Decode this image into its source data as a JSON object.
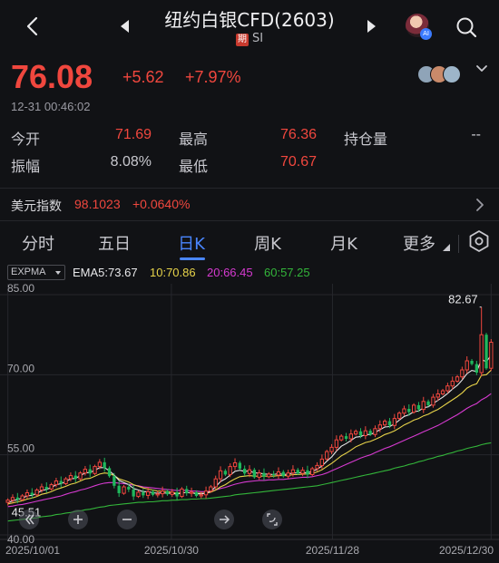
{
  "header": {
    "title": "纽约白银CFD(2603)",
    "badge": "期",
    "code": "SI"
  },
  "quote": {
    "price": "76.08",
    "change": "+5.62",
    "change_pct": "+7.97%",
    "time": "12-31 00:46:02"
  },
  "stats": {
    "open_label": "今开",
    "open": "71.69",
    "high_label": "最高",
    "high": "76.36",
    "oi_label": "持仓量",
    "oi": "--",
    "amp_label": "振幅",
    "amp": "8.08%",
    "low_label": "最低",
    "low": "70.67"
  },
  "usd_index": {
    "label": "美元指数",
    "value": "98.1023",
    "change": "+0.0640%"
  },
  "tabs": [
    {
      "label": "分时"
    },
    {
      "label": "五日"
    },
    {
      "label": "日K"
    },
    {
      "label": "周K"
    },
    {
      "label": "月K"
    },
    {
      "label": "更多"
    }
  ],
  "indicator": {
    "selected": "EXPMA",
    "ema5": "EMA5:73.67",
    "ema10": "10:70.86",
    "ema20": "20:66.45",
    "ema60": "60:57.25"
  },
  "colors": {
    "up": "#f0473e",
    "down": "#1fb75c",
    "ema5": "#e8e8ea",
    "ema10": "#e8d44a",
    "ema20": "#d63ad0",
    "ema60": "#33b53a",
    "accent": "#4a86ff"
  },
  "chart_data": {
    "type": "candlestick",
    "y_ticks": [
      "85.00",
      "70.00",
      "55.00",
      "40.00"
    ],
    "ylim": [
      40,
      85
    ],
    "x_ticks": [
      "2025/10/01",
      "2025/10/30",
      "2025/11/28",
      "2025/12/30"
    ],
    "annotations": {
      "max": "82.67",
      "min": "45.51"
    },
    "closes": [
      46.5,
      47.0,
      46.6,
      47.3,
      47.9,
      47.5,
      48.4,
      49.0,
      48.6,
      49.4,
      50.1,
      49.6,
      50.5,
      51.1,
      50.5,
      51.6,
      52.3,
      51.5,
      52.8,
      53.6,
      52.5,
      51.0,
      49.2,
      47.8,
      49.0,
      48.5,
      47.2,
      48.0,
      47.4,
      48.1,
      47.5,
      47.7,
      48.2,
      47.6,
      48.0,
      47.2,
      48.6,
      47.8,
      48.0,
      47.3,
      47.5,
      48.2,
      49.0,
      50.5,
      52.0,
      51.3,
      52.8,
      53.5,
      52.4,
      51.5,
      52.2,
      50.8,
      51.6,
      50.9,
      51.4,
      51.2,
      51.8,
      51.0,
      51.6,
      52.2,
      51.5,
      52.1,
      51.3,
      52.4,
      53.0,
      54.2,
      55.6,
      56.4,
      57.8,
      58.5,
      58.0,
      58.9,
      59.4,
      58.6,
      59.5,
      58.8,
      59.9,
      60.6,
      61.3,
      60.5,
      61.8,
      62.8,
      63.6,
      63.0,
      64.3,
      63.5,
      65.0,
      64.3,
      65.8,
      66.4,
      67.0,
      67.9,
      68.8,
      69.6,
      70.9,
      72.6,
      72.0,
      70.4,
      77.5,
      71.2,
      76.08
    ],
    "ema5": [
      46.0,
      46.4,
      46.6,
      46.9,
      47.3,
      47.4,
      47.8,
      48.3,
      48.5,
      48.9,
      49.4,
      49.6,
      50.0,
      50.5,
      50.6,
      51.1,
      51.6,
      51.7,
      52.1,
      52.6,
      52.6,
      52.0,
      51.2,
      50.2,
      49.8,
      49.4,
      48.7,
      48.4,
      48.1,
      48.1,
      47.9,
      47.8,
      47.9,
      47.8,
      47.8,
      47.6,
      47.9,
      47.9,
      47.9,
      47.7,
      47.7,
      47.8,
      48.2,
      49.0,
      50.0,
      50.5,
      51.2,
      51.9,
      52.1,
      51.9,
      52.0,
      51.6,
      51.6,
      51.4,
      51.4,
      51.3,
      51.5,
      51.3,
      51.4,
      51.6,
      51.6,
      51.7,
      51.6,
      51.9,
      52.3,
      52.9,
      53.8,
      54.6,
      55.7,
      56.6,
      57.1,
      57.7,
      58.3,
      58.4,
      58.8,
      58.8,
      59.2,
      59.7,
      60.2,
      60.3,
      60.8,
      61.5,
      62.2,
      62.5,
      63.1,
      63.2,
      63.8,
      64.0,
      64.6,
      65.2,
      65.8,
      66.5,
      67.3,
      68.0,
      69.0,
      70.2,
      70.8,
      70.6,
      72.9,
      72.4,
      73.67
    ],
    "ema10": [
      45.8,
      46.0,
      46.2,
      46.4,
      46.7,
      46.9,
      47.2,
      47.6,
      47.8,
      48.1,
      48.5,
      48.8,
      49.1,
      49.5,
      49.7,
      50.1,
      50.5,
      50.6,
      51.0,
      51.4,
      51.6,
      51.5,
      51.1,
      50.5,
      50.2,
      49.9,
      49.4,
      49.1,
      48.8,
      48.6,
      48.4,
      48.2,
      48.2,
      48.1,
      48.0,
      47.8,
      47.9,
      47.9,
      47.9,
      47.8,
      47.8,
      47.8,
      48.0,
      48.4,
      49.0,
      49.4,
      50.0,
      50.5,
      50.9,
      51.0,
      51.1,
      51.0,
      51.0,
      51.0,
      51.0,
      51.0,
      51.1,
      51.1,
      51.1,
      51.3,
      51.3,
      51.4,
      51.4,
      51.5,
      51.8,
      52.2,
      52.8,
      53.4,
      54.1,
      54.8,
      55.3,
      55.9,
      56.5,
      56.9,
      57.3,
      57.5,
      57.9,
      58.3,
      58.8,
      59.1,
      59.5,
      60.0,
      60.6,
      61.0,
      61.5,
      61.8,
      62.3,
      62.6,
      63.1,
      63.5,
      64.1,
      64.7,
      65.3,
      65.9,
      66.6,
      67.5,
      68.0,
      68.3,
      69.9,
      70.0,
      70.86
    ],
    "ema20": [
      45.3,
      45.4,
      45.6,
      45.7,
      45.9,
      46.1,
      46.3,
      46.5,
      46.7,
      46.9,
      47.1,
      47.3,
      47.6,
      47.9,
      48.1,
      48.4,
      48.6,
      48.9,
      49.2,
      49.5,
      49.7,
      49.8,
      49.8,
      49.7,
      49.6,
      49.5,
      49.3,
      49.2,
      49.0,
      48.9,
      48.8,
      48.7,
      48.6,
      48.5,
      48.4,
      48.3,
      48.3,
      48.3,
      48.2,
      48.2,
      48.1,
      48.1,
      48.2,
      48.4,
      48.7,
      48.9,
      49.2,
      49.5,
      49.7,
      49.9,
      50.0,
      50.1,
      50.2,
      50.2,
      50.3,
      50.3,
      50.4,
      50.4,
      50.5,
      50.6,
      50.7,
      50.8,
      50.8,
      50.9,
      51.1,
      51.3,
      51.6,
      52.0,
      52.4,
      52.8,
      53.2,
      53.6,
      54.0,
      54.4,
      54.7,
      55.0,
      55.4,
      55.8,
      56.2,
      56.5,
      56.9,
      57.3,
      57.7,
      58.1,
      58.5,
      58.9,
      59.3,
      59.7,
      60.1,
      60.5,
      61.0,
      61.5,
      62.0,
      62.5,
      63.1,
      63.7,
      64.2,
      64.6,
      65.3,
      65.8,
      66.45
    ],
    "ema60": [
      42.6,
      42.7,
      42.8,
      42.9,
      43.0,
      43.1,
      43.2,
      43.4,
      43.5,
      43.6,
      43.8,
      43.9,
      44.1,
      44.2,
      44.4,
      44.5,
      44.7,
      44.8,
      45.0,
      45.2,
      45.3,
      45.5,
      45.6,
      45.7,
      45.8,
      45.9,
      46.0,
      46.1,
      46.1,
      46.2,
      46.2,
      46.3,
      46.4,
      46.4,
      46.5,
      46.5,
      46.6,
      46.6,
      46.7,
      46.7,
      46.8,
      46.8,
      46.9,
      47.0,
      47.1,
      47.2,
      47.3,
      47.5,
      47.6,
      47.7,
      47.8,
      47.9,
      48.0,
      48.1,
      48.2,
      48.3,
      48.4,
      48.5,
      48.6,
      48.7,
      48.8,
      48.9,
      49.0,
      49.1,
      49.2,
      49.4,
      49.6,
      49.8,
      50.0,
      50.2,
      50.4,
      50.6,
      50.8,
      51.0,
      51.2,
      51.4,
      51.6,
      51.8,
      52.0,
      52.2,
      52.5,
      52.7,
      52.9,
      53.2,
      53.4,
      53.7,
      53.9,
      54.2,
      54.4,
      54.7,
      54.9,
      55.2,
      55.4,
      55.7,
      55.9,
      56.2,
      56.4,
      56.6,
      56.9,
      57.1,
      57.25
    ]
  }
}
